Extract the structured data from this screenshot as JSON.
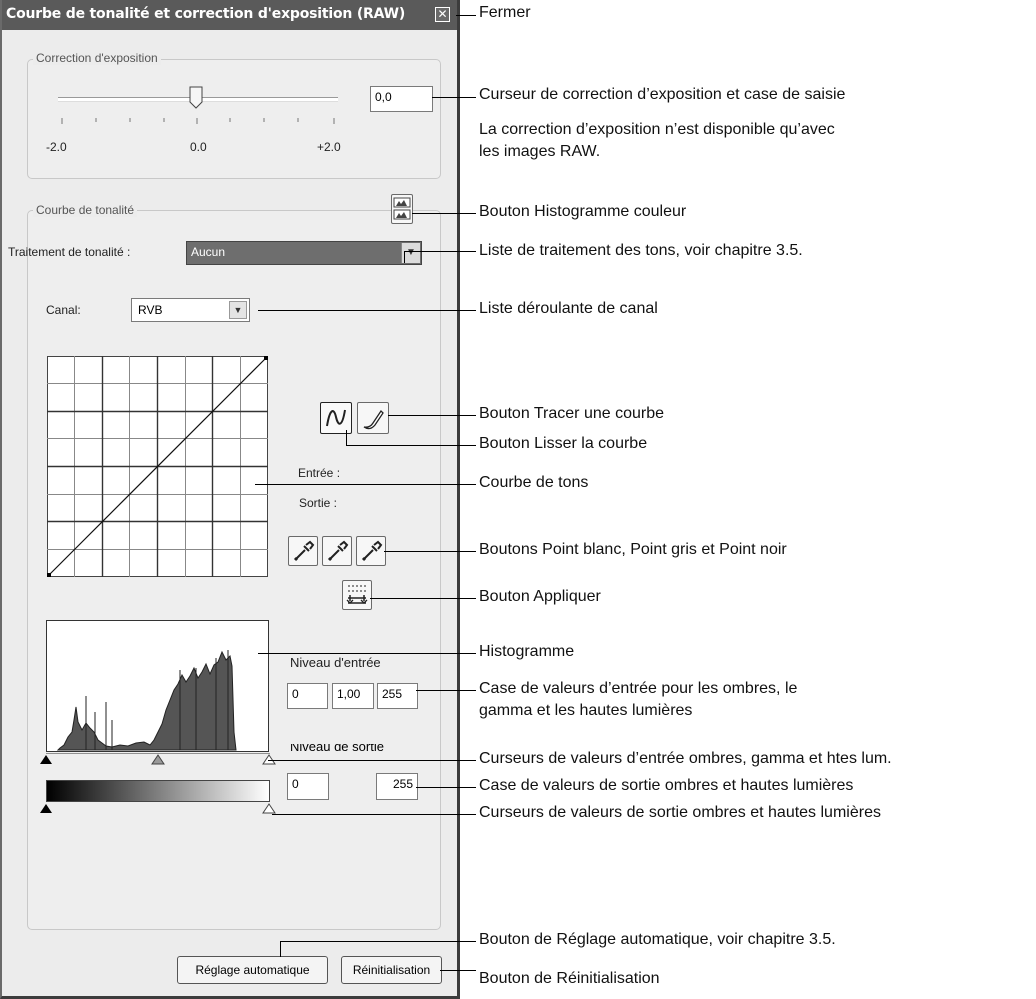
{
  "dialog": {
    "title": "Courbe de tonalité et correction d'exposition (RAW)",
    "close_glyph": "✕",
    "exposure": {
      "group_label": "Correction d'exposition",
      "value": "0,0",
      "tick_labels": [
        "-2.0",
        "0.0",
        "+2.0"
      ]
    },
    "tone": {
      "group_label": "Courbe de tonalité",
      "processing_label": "Traitement de tonalité :",
      "processing_value": "Aucun",
      "channel_label": "Canal:",
      "channel_value": "RVB",
      "input_label": "Entrée :",
      "output_label": "Sortie :",
      "input_level_label": "Niveau d'entrée",
      "input_shadow": "0",
      "input_gamma": "1,00",
      "input_highlight": "255",
      "output_level_label": "Niveau de sortie",
      "output_shadow": "0",
      "output_highlight": "255"
    },
    "buttons": {
      "auto_label": "Réglage automatique",
      "reset_label": "Réinitialisation"
    }
  },
  "annotations": {
    "close": "Fermer",
    "exposure_slider": "Curseur de correction d’exposition et case de saisie",
    "raw_note_1": "La correction d’exposition n’est disponible qu’avec",
    "raw_note_2": "les images RAW.",
    "color_histogram": "Bouton Histogramme couleur",
    "tone_list": "Liste de traitement des tons, voir chapitre 3.5.",
    "channel_list": "Liste déroulante de canal",
    "draw_curve": "Bouton Tracer une courbe",
    "smooth_curve": "Bouton Lisser la courbe",
    "tone_curve": "Courbe de tons",
    "point_buttons": "Boutons Point blanc, Point gris et Point noir",
    "apply": "Bouton Appliquer",
    "histogram": "Histogramme",
    "input_values_1": "Case de valeurs d’entrée pour les ombres, le",
    "input_values_2": "gamma et les hautes lumières",
    "input_sliders": "Curseurs de valeurs d’entrée ombres, gamma et htes lum.",
    "output_values": "Case de valeurs de sortie ombres et hautes lumières",
    "output_sliders": "Curseurs de valeurs de sortie ombres et hautes lumières",
    "auto_button": "Bouton de Réglage automatique, voir chapitre 3.5.",
    "reset_button": "Bouton de Réinitialisation"
  },
  "colors": {
    "titlebar": "#5a5a5a",
    "dialog_bg": "#ececec",
    "processing_field": "#6e6e6e"
  }
}
